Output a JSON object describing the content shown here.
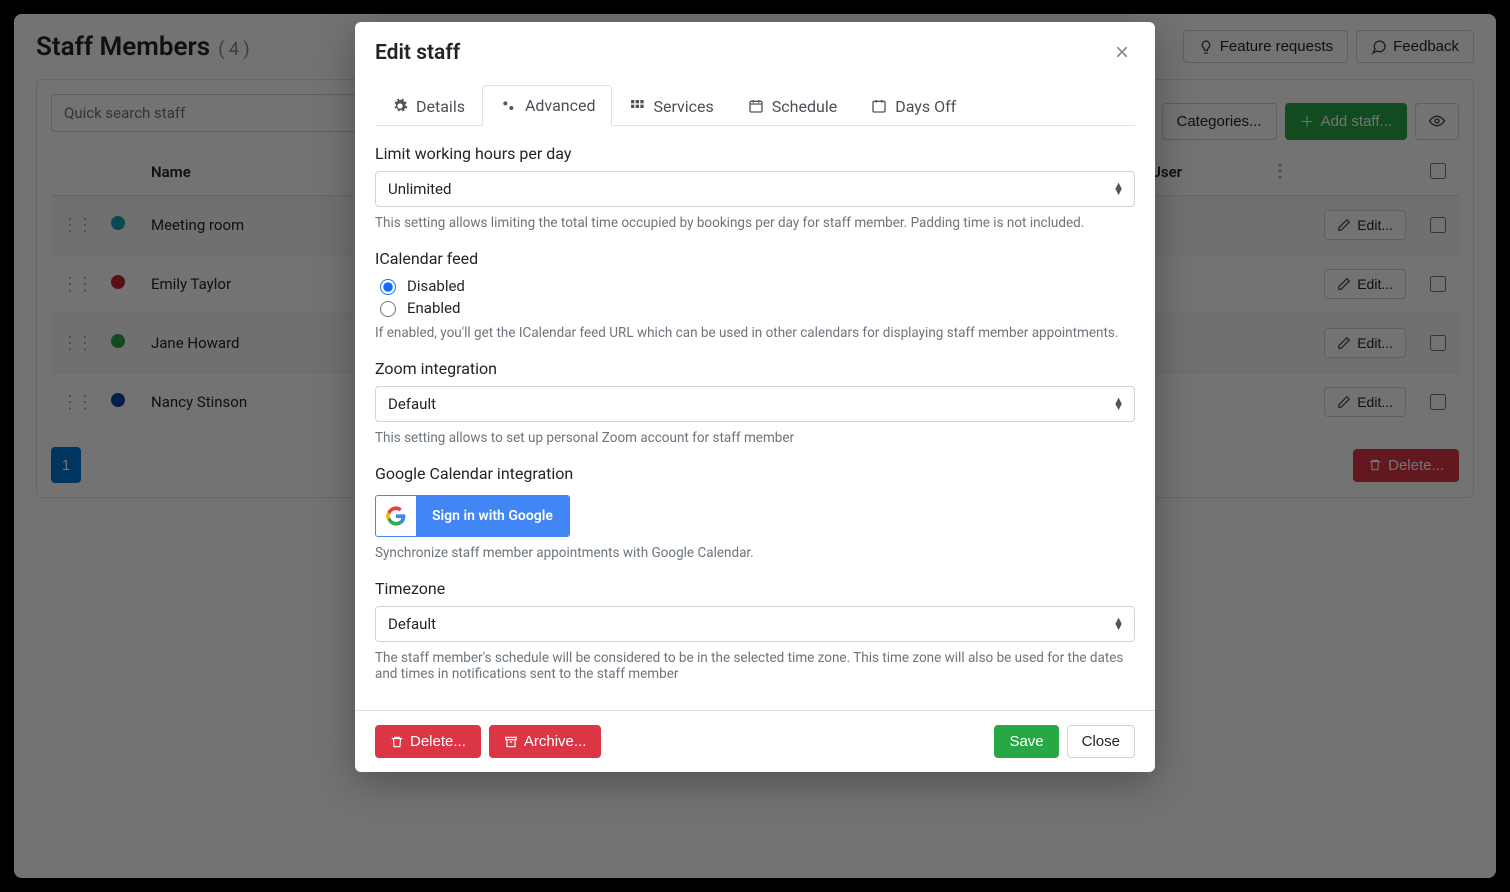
{
  "header": {
    "title": "Staff Members",
    "count": "( 4 )",
    "buttons": {
      "feature": "Feature requests",
      "feedback": "Feedback",
      "categories": "Categories...",
      "add_staff": "Add staff..."
    }
  },
  "search": {
    "placeholder": "Quick search staff"
  },
  "table": {
    "columns": {
      "name": "Name",
      "user": "User"
    },
    "edit_label": "Edit...",
    "rows": [
      {
        "color": "#17a2b8",
        "name": "Meeting room"
      },
      {
        "color": "#c82333",
        "name": "Emily Taylor"
      },
      {
        "color": "#28a745",
        "name": "Jane Howard"
      },
      {
        "color": "#0d47a1",
        "name": "Nancy Stinson"
      }
    ],
    "page": "1",
    "delete_label": "Delete..."
  },
  "modal": {
    "title": "Edit staff",
    "tabs": {
      "details": "Details",
      "advanced": "Advanced",
      "services": "Services",
      "schedule": "Schedule",
      "daysoff": "Days Off"
    },
    "limit": {
      "label": "Limit working hours per day",
      "value": "Unlimited",
      "help": "This setting allows limiting the total time occupied by bookings per day for staff member. Padding time is not included."
    },
    "ical": {
      "label": "ICalendar feed",
      "opt_disabled": "Disabled",
      "opt_enabled": "Enabled",
      "help": "If enabled, you'll get the ICalendar feed URL which can be used in other calendars for displaying staff member appointments."
    },
    "zoom": {
      "label": "Zoom integration",
      "value": "Default",
      "help": "This setting allows to set up personal Zoom account for staff member"
    },
    "google": {
      "label": "Google Calendar integration",
      "button": "Sign in with Google",
      "help": "Synchronize staff member appointments with Google Calendar."
    },
    "tz": {
      "label": "Timezone",
      "value": "Default",
      "help": "The staff member's schedule will be considered to be in the selected time zone. This time zone will also be used for the dates and times in notifications sent to the staff member"
    },
    "footer": {
      "delete": "Delete...",
      "archive": "Archive...",
      "save": "Save",
      "close": "Close"
    }
  }
}
